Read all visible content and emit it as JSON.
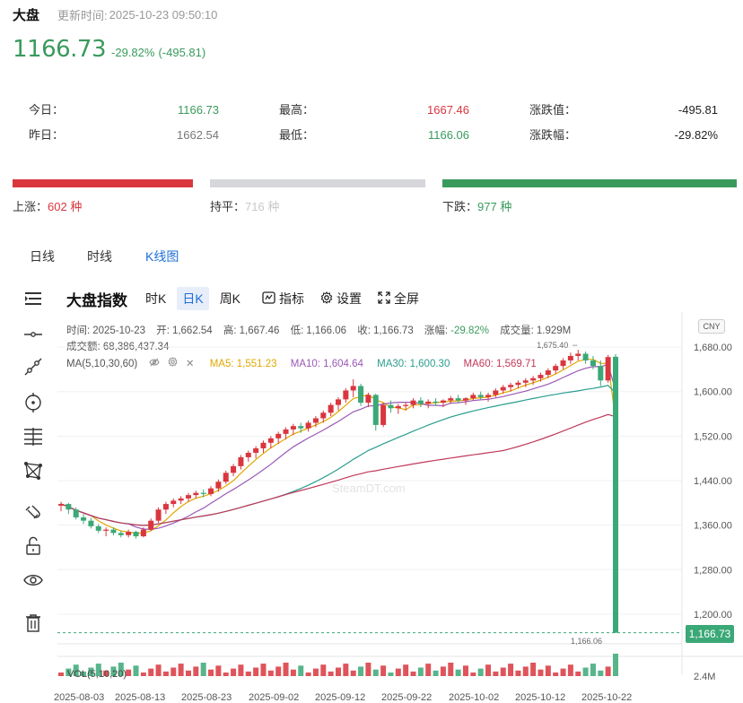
{
  "header": {
    "title": "大盘",
    "update_label": "更新时间:",
    "update_time": "2025-10-23 09:50:10"
  },
  "price": {
    "current": "1166.73",
    "change_pct": "-29.82%",
    "change_abs": "(-495.81)"
  },
  "stats": {
    "today_label": "今日：",
    "today": "1166.73",
    "yesterday_label": "昨日：",
    "yesterday": "1662.54",
    "high_label": "最高：",
    "high": "1667.46",
    "low_label": "最低：",
    "low": "1166.06",
    "change_val_label": "涨跌值：",
    "change_val": "-495.81",
    "change_pct_label": "涨跌幅：",
    "change_pct": "-29.82%"
  },
  "breadth": {
    "up_label": "上涨：",
    "up_value": "602",
    "up_unit": "种",
    "flat_label": "持平：",
    "flat_value": "716",
    "flat_unit": "种",
    "down_label": "下跌：",
    "down_value": "977",
    "down_unit": "种",
    "colors": {
      "up": "#d9363e",
      "flat": "#d5d7da",
      "down": "#3a9a5d"
    }
  },
  "tabs": [
    {
      "label": "日线",
      "active": false
    },
    {
      "label": "时线",
      "active": false
    },
    {
      "label": "K线图",
      "active": true
    }
  ],
  "kchart": {
    "title": "大盘指数",
    "periods": [
      {
        "label": "时K",
        "active": false
      },
      {
        "label": "日K",
        "active": true
      },
      {
        "label": "周K",
        "active": false
      }
    ],
    "indicator_label": "指标",
    "settings_label": "设置",
    "fullscreen_label": "全屏",
    "info": {
      "time_label": "时间:",
      "time": "2025-10-23",
      "open_label": "开:",
      "open": "1,662.54",
      "high_label": "高:",
      "high": "1,667.46",
      "low_label": "低:",
      "low": "1,166.06",
      "close_label": "收:",
      "close": "1,166.73",
      "chg_label": "涨幅:",
      "chg": "-29.82%",
      "vol_label": "成交量:",
      "vol": "1.929M",
      "amount_label": "成交额:",
      "amount": "68,386,437.34"
    },
    "ma": {
      "label": "MA(5,10,30,60)",
      "ma5": "MA5: 1,551.23",
      "ma10": "MA10: 1,604.64",
      "ma30": "MA30: 1,600.30",
      "ma60": "MA60: 1,569.71",
      "colors": {
        "ma5": "#e0a800",
        "ma10": "#9b59b6",
        "ma30": "#2a9d8f",
        "ma60": "#c0395a"
      }
    },
    "currency": "CNY",
    "last_price_tag": "1,166.73",
    "vol_legend": "VOL(5,10,20)",
    "vol_axis_label": "2.4M",
    "watermark": "SteamDT.com",
    "icons": [
      "menu-icon",
      "horizontal-line-icon",
      "trend-line-icon",
      "crosshair-icon",
      "fib-lines-icon",
      "pattern-icon",
      "magnet-icon",
      "lock-icon",
      "eye-icon",
      "trash-icon"
    ]
  },
  "chart_data": {
    "type": "candlestick",
    "y_ticks": [
      "1,680.00",
      "1,600.00",
      "1,520.00",
      "1,440.00",
      "1,360.00",
      "1,280.00",
      "1,200.00"
    ],
    "y_tick_values": [
      1680,
      1600,
      1520,
      1440,
      1360,
      1280,
      1200
    ],
    "ylim": [
      1150,
      1730
    ],
    "x_ticks": [
      "2025-08-03",
      "2025-08-13",
      "2025-08-23",
      "2025-09-02",
      "2025-09-12",
      "2025-09-22",
      "2025-10-02",
      "2025-10-12",
      "2025-10-22"
    ],
    "annotations": {
      "high_mark": "1,675.40",
      "low_mark": "1,166.06"
    },
    "candles": [
      [
        1395,
        1402,
        1385,
        1398
      ],
      [
        1398,
        1400,
        1380,
        1388
      ],
      [
        1388,
        1392,
        1370,
        1374
      ],
      [
        1374,
        1380,
        1362,
        1368
      ],
      [
        1368,
        1373,
        1354,
        1358
      ],
      [
        1358,
        1362,
        1346,
        1350
      ],
      [
        1350,
        1356,
        1340,
        1352
      ],
      [
        1352,
        1356,
        1342,
        1346
      ],
      [
        1346,
        1350,
        1338,
        1342
      ],
      [
        1342,
        1352,
        1338,
        1348
      ],
      [
        1348,
        1350,
        1336,
        1340
      ],
      [
        1340,
        1356,
        1338,
        1352
      ],
      [
        1352,
        1372,
        1350,
        1368
      ],
      [
        1368,
        1392,
        1364,
        1388
      ],
      [
        1388,
        1402,
        1380,
        1398
      ],
      [
        1398,
        1408,
        1392,
        1404
      ],
      [
        1404,
        1412,
        1398,
        1408
      ],
      [
        1408,
        1418,
        1402,
        1414
      ],
      [
        1414,
        1422,
        1408,
        1418
      ],
      [
        1418,
        1424,
        1410,
        1416
      ],
      [
        1416,
        1430,
        1412,
        1426
      ],
      [
        1426,
        1442,
        1420,
        1438
      ],
      [
        1438,
        1458,
        1434,
        1454
      ],
      [
        1454,
        1470,
        1448,
        1466
      ],
      [
        1466,
        1486,
        1460,
        1482
      ],
      [
        1482,
        1494,
        1474,
        1490
      ],
      [
        1490,
        1502,
        1480,
        1498
      ],
      [
        1498,
        1512,
        1490,
        1508
      ],
      [
        1508,
        1520,
        1498,
        1516
      ],
      [
        1516,
        1528,
        1506,
        1524
      ],
      [
        1524,
        1536,
        1514,
        1532
      ],
      [
        1532,
        1542,
        1522,
        1538
      ],
      [
        1538,
        1544,
        1526,
        1534
      ],
      [
        1534,
        1548,
        1528,
        1544
      ],
      [
        1544,
        1556,
        1536,
        1552
      ],
      [
        1552,
        1566,
        1544,
        1562
      ],
      [
        1562,
        1580,
        1556,
        1576
      ],
      [
        1576,
        1590,
        1566,
        1586
      ],
      [
        1586,
        1606,
        1580,
        1602
      ],
      [
        1602,
        1622,
        1590,
        1610
      ],
      [
        1610,
        1614,
        1574,
        1580
      ],
      [
        1580,
        1598,
        1572,
        1594
      ],
      [
        1594,
        1596,
        1530,
        1540
      ],
      [
        1540,
        1580,
        1536,
        1576
      ],
      [
        1576,
        1584,
        1562,
        1570
      ],
      [
        1570,
        1578,
        1560,
        1574
      ],
      [
        1574,
        1580,
        1566,
        1576
      ],
      [
        1576,
        1588,
        1570,
        1584
      ],
      [
        1584,
        1590,
        1572,
        1578
      ],
      [
        1578,
        1586,
        1570,
        1582
      ],
      [
        1582,
        1588,
        1574,
        1580
      ],
      [
        1580,
        1586,
        1572,
        1584
      ],
      [
        1584,
        1592,
        1578,
        1588
      ],
      [
        1588,
        1594,
        1580,
        1584
      ],
      [
        1584,
        1590,
        1576,
        1588
      ],
      [
        1588,
        1598,
        1584,
        1594
      ],
      [
        1594,
        1600,
        1586,
        1590
      ],
      [
        1590,
        1598,
        1582,
        1594
      ],
      [
        1594,
        1606,
        1590,
        1602
      ],
      [
        1602,
        1612,
        1596,
        1608
      ],
      [
        1608,
        1616,
        1600,
        1612
      ],
      [
        1612,
        1620,
        1606,
        1616
      ],
      [
        1616,
        1624,
        1608,
        1620
      ],
      [
        1620,
        1628,
        1612,
        1624
      ],
      [
        1624,
        1634,
        1618,
        1630
      ],
      [
        1630,
        1642,
        1624,
        1638
      ],
      [
        1638,
        1650,
        1632,
        1646
      ],
      [
        1646,
        1660,
        1640,
        1656
      ],
      [
        1656,
        1670,
        1650,
        1664
      ],
      [
        1664,
        1675,
        1656,
        1668
      ],
      [
        1668,
        1672,
        1650,
        1656
      ],
      [
        1656,
        1664,
        1640,
        1646
      ],
      [
        1646,
        1656,
        1610,
        1620
      ],
      [
        1620,
        1666,
        1616,
        1662
      ],
      [
        1662.54,
        1667.46,
        1166.06,
        1166.73
      ]
    ]
  }
}
